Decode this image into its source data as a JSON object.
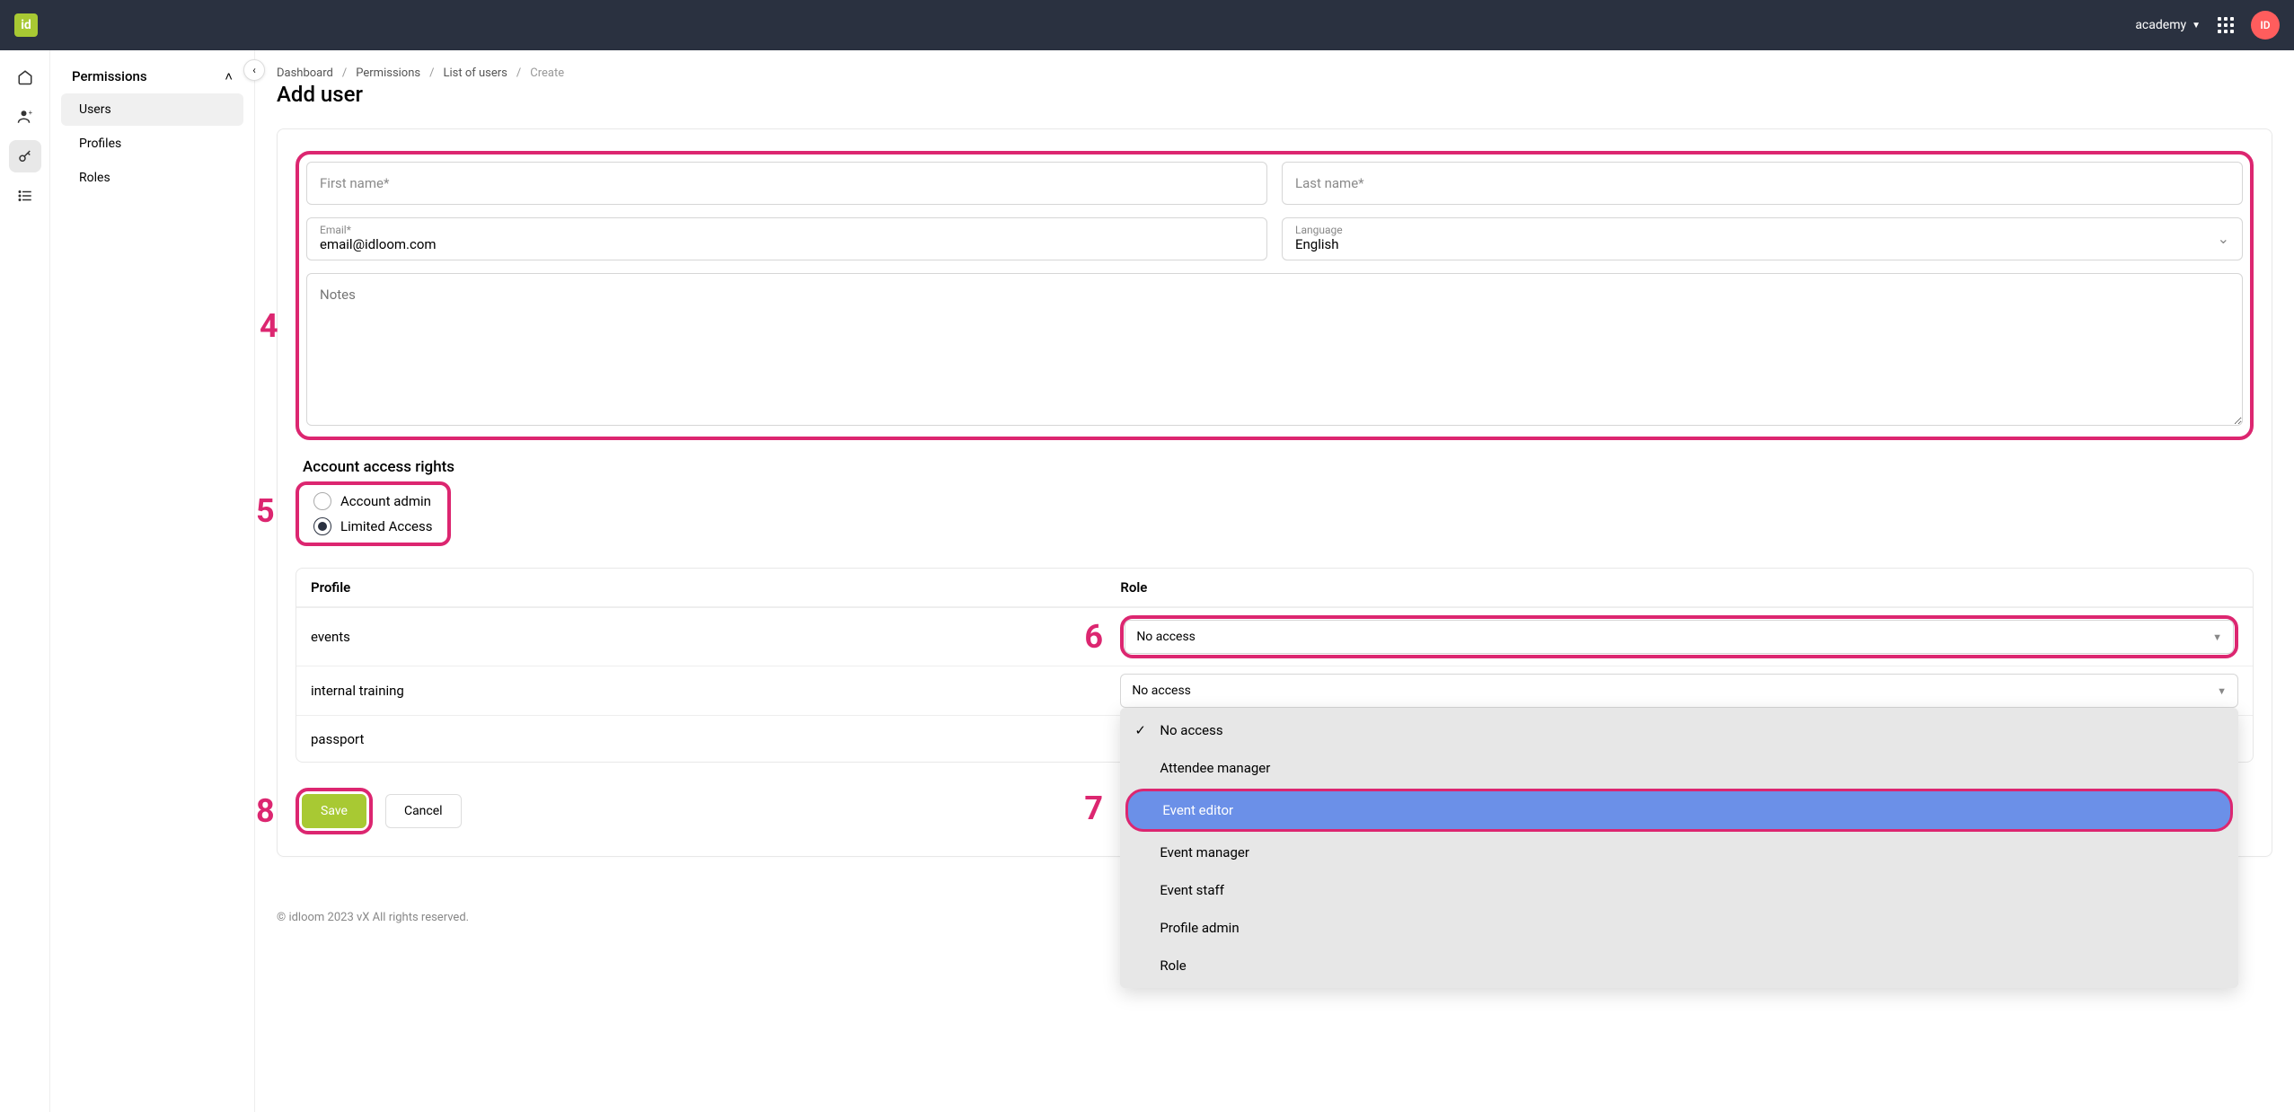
{
  "navbar": {
    "logo_text": "id",
    "account_label": "academy",
    "avatar_initials": "ID"
  },
  "sidebar": {
    "title": "Permissions",
    "items": [
      {
        "label": "Users",
        "active": true
      },
      {
        "label": "Profiles",
        "active": false
      },
      {
        "label": "Roles",
        "active": false
      }
    ]
  },
  "breadcrumb": {
    "items": [
      "Dashboard",
      "Permissions",
      "List of users",
      "Create"
    ]
  },
  "page": {
    "title": "Add user"
  },
  "form": {
    "first_name_placeholder": "First name*",
    "last_name_placeholder": "Last name*",
    "email_label": "Email*",
    "email_value": "email@idloom.com",
    "language_label": "Language",
    "language_value": "English",
    "notes_placeholder": "Notes"
  },
  "access_rights": {
    "section_title": "Account access rights",
    "options": [
      {
        "label": "Account admin",
        "checked": false
      },
      {
        "label": "Limited Access",
        "checked": true
      }
    ]
  },
  "table": {
    "headers": {
      "profile": "Profile",
      "role": "Role"
    },
    "rows": [
      {
        "profile": "events",
        "role": "No access"
      },
      {
        "profile": "internal training",
        "role": "No access"
      },
      {
        "profile": "passport",
        "role": ""
      }
    ]
  },
  "dropdown": {
    "options": [
      {
        "label": "No access",
        "checked": true
      },
      {
        "label": "Attendee manager"
      },
      {
        "label": "Event editor",
        "highlighted": true
      },
      {
        "label": "Event manager"
      },
      {
        "label": "Event staff"
      },
      {
        "label": "Profile admin"
      },
      {
        "label": "Role"
      }
    ]
  },
  "buttons": {
    "save": "Save",
    "cancel": "Cancel"
  },
  "annotations": {
    "a4": "4",
    "a5": "5",
    "a6": "6",
    "a7": "7",
    "a8": "8"
  },
  "footer": {
    "copyright": "© idloom 2023 vX All rights reserved."
  }
}
